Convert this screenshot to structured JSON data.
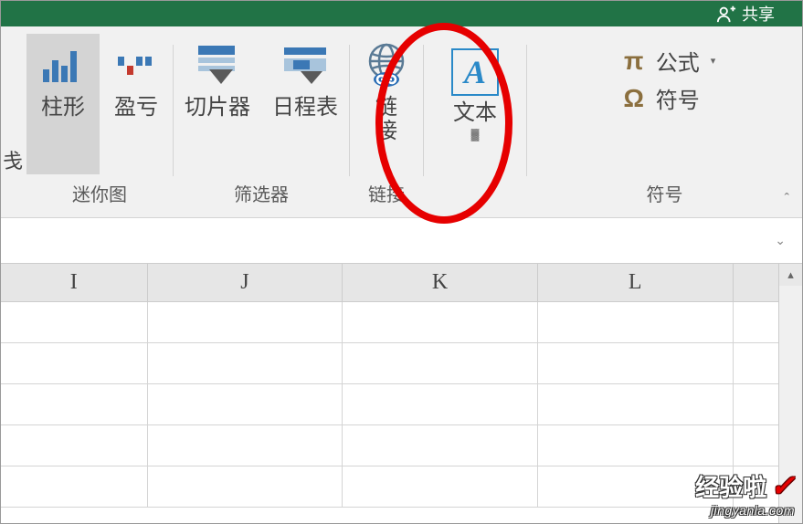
{
  "titlebar": {
    "share_label": "共享"
  },
  "ribbon": {
    "sparklines": {
      "column_label": "柱形",
      "winloss_label": "盈亏",
      "group_label": "迷你图",
      "edge_fragment": "戋"
    },
    "filters": {
      "slicer_label": "切片器",
      "timeline_label": "日程表",
      "group_label": "筛选器"
    },
    "links": {
      "link_label_line1": "链",
      "link_label_line2": "接",
      "group_label": "链接"
    },
    "text": {
      "text_label": "文本"
    },
    "symbols": {
      "formula_label": "公式",
      "symbol_label": "符号",
      "group_label": "符号"
    }
  },
  "columns": [
    "I",
    "J",
    "K",
    "L"
  ],
  "watermark": {
    "main": "经验啦",
    "sub": "jingyanla.com"
  }
}
